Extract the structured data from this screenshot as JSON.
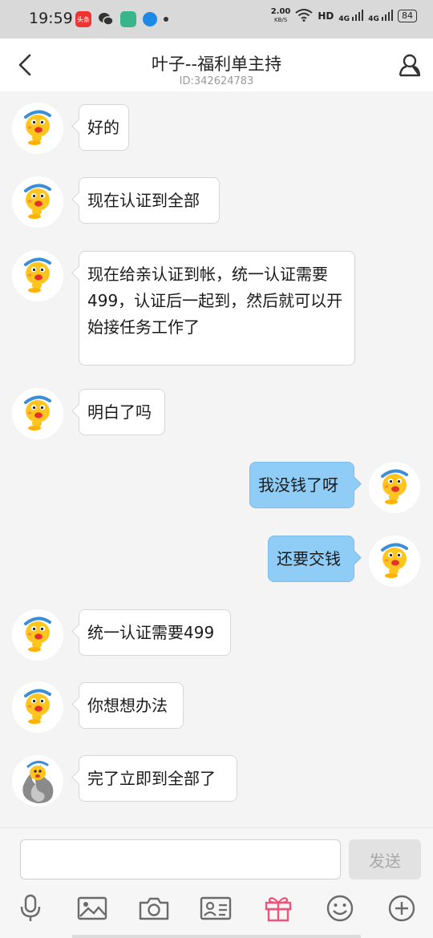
{
  "status_bar": {
    "time": "19:59",
    "app_toutiao": "头条",
    "net_speed": "2.00",
    "net_speed_unit": "KB/S",
    "hd": "HD",
    "signal1": "4G",
    "signal2": "4G",
    "battery": "84"
  },
  "header": {
    "title": "叶子--福利单主持",
    "subtitle": "ID:342624783"
  },
  "messages": [
    {
      "side": "in",
      "text": "好的"
    },
    {
      "side": "in",
      "text": "现在认证到全部"
    },
    {
      "side": "in",
      "text": "现在给亲认证到帐，统一认证需要499，认证后一起到，然后就可以开始接任务工作了"
    },
    {
      "side": "in",
      "text": "明白了吗"
    },
    {
      "side": "out",
      "text": "我没钱了呀"
    },
    {
      "side": "out",
      "text": "还要交钱"
    },
    {
      "side": "in",
      "text": "统一认证需要499"
    },
    {
      "side": "in",
      "text": "你想想办法"
    },
    {
      "side": "in",
      "text": "完了立即到全部了"
    }
  ],
  "input": {
    "placeholder": "",
    "send_label": "发送"
  },
  "toolbar": [
    "microphone-icon",
    "image-icon",
    "camera-icon",
    "contact-card-icon",
    "gift-icon",
    "emoji-icon",
    "plus-icon"
  ],
  "colors": {
    "outgoing_bubble": "#8fcdf7",
    "incoming_bubble": "#ffffff",
    "gift_accent": "#f0527a"
  }
}
